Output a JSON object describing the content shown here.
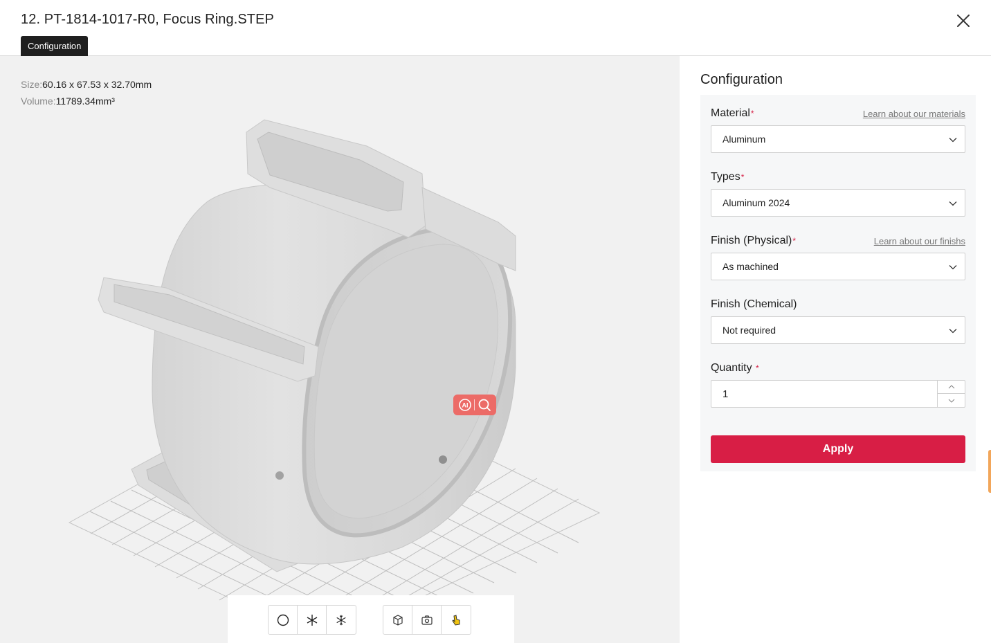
{
  "header": {
    "title": "12. PT-1814-1017-R0, Focus Ring.STEP",
    "tab_label": "Configuration"
  },
  "viewer": {
    "size_label": "Size:",
    "size_value": "60.16 x 67.53 x 32.70mm",
    "volume_label": "Volume:",
    "volume_value": "11789.34mm³",
    "ai_badge_text": "AI",
    "toolbar": {
      "group1": [
        "circle-icon",
        "asterisk-icon",
        "snowflake-icon"
      ],
      "group2": [
        "cube-icon",
        "camera-rotate-icon",
        "hand-pointer-icon"
      ]
    }
  },
  "panel": {
    "title": "Configuration",
    "material": {
      "label": "Material",
      "required": "*",
      "learn_link": "Learn about our materials",
      "value": "Aluminum"
    },
    "types": {
      "label": "Types",
      "required": "*",
      "value": "Aluminum 2024"
    },
    "finish_physical": {
      "label": "Finish (Physical)",
      "required": "*",
      "learn_link": "Learn about our finishs",
      "value": "As machined"
    },
    "finish_chemical": {
      "label": "Finish (Chemical)",
      "value": "Not required"
    },
    "quantity": {
      "label": "Quantity",
      "required": "*",
      "value": "1"
    },
    "apply_label": "Apply"
  },
  "colors": {
    "accent": "#d81e45",
    "badge": "#ec6b67",
    "viewer_bg": "#f1f1f1",
    "card_bg": "#f6f7f8"
  }
}
